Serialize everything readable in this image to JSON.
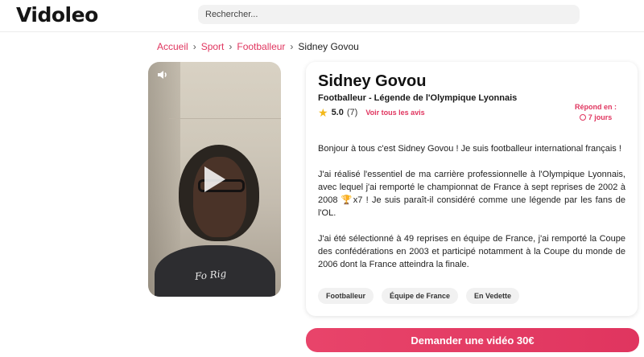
{
  "header": {
    "logo": "Vidoleo",
    "search_placeholder": "Rechercher..."
  },
  "breadcrumb": {
    "items": [
      "Accueil",
      "Sport",
      "Footballeur"
    ],
    "current": "Sidney Govou",
    "separator": "›"
  },
  "video": {
    "shirt_text": "Fo Rig",
    "icons": {
      "sound": "sound-icon",
      "play": "play-icon"
    }
  },
  "profile": {
    "name": "Sidney Govou",
    "subtitle": "Footballeur - Légende de l'Olympique Lyonnais",
    "rating": "5.0",
    "rating_count": "(7)",
    "reviews_link": "Voir tous les avis",
    "response_label": "Répond en :",
    "response_time": "7 jours",
    "bio": [
      "Bonjour à tous c'est Sidney Govou ! Je suis footballeur international français !",
      "J'ai réalisé l'essentiel de ma carrière professionnelle à l'Olympique Lyonnais, avec lequel j'ai remporté le championnat de France à sept reprises de 2002 à 2008 🏆x7 ! Je suis paraît-il considéré comme une légende par les fans de l'OL.",
      "J'ai été sélectionné à 49 reprises en équipe de France, j'ai remporté la Coupe des confédérations en 2003 et participé notamment à la Coupe du monde de 2006 dont la France atteindra la finale."
    ],
    "tags": [
      "Footballeur",
      "Équipe de France",
      "En Vedette"
    ]
  },
  "cta": {
    "label": "Demander une vidéo 30€"
  },
  "colors": {
    "accent": "#e0355f",
    "star": "#f3b81a"
  }
}
